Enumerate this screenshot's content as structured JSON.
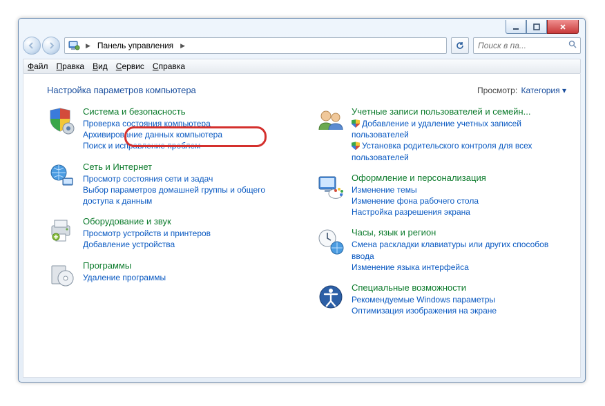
{
  "window": {
    "breadcrumb": "Панель управления",
    "search_placeholder": "Поиск в па..."
  },
  "menu": {
    "file": "Файл",
    "edit": "Правка",
    "view": "Вид",
    "tools": "Сервис",
    "help": "Справка"
  },
  "header": {
    "title": "Настройка параметров компьютера",
    "view_label": "Просмотр:",
    "view_value": "Категория"
  },
  "left": [
    {
      "title": "Система и безопасность",
      "subs": [
        "Проверка состояния компьютера",
        "Архивирование данных компьютера",
        "Поиск и исправление проблем"
      ]
    },
    {
      "title": "Сеть и Интернет",
      "subs": [
        "Просмотр состояния сети и задач",
        "Выбор параметров домашней группы и общего доступа к данным"
      ]
    },
    {
      "title": "Оборудование и звук",
      "subs": [
        "Просмотр устройств и принтеров",
        "Добавление устройства"
      ]
    },
    {
      "title": "Программы",
      "subs": [
        "Удаление программы"
      ]
    }
  ],
  "right": [
    {
      "title": "Учетные записи пользователей и семейн...",
      "subs": [
        {
          "t": "Добавление и удаление учетных записей пользователей",
          "shield": true
        },
        {
          "t": "Установка родительского контроля для всех пользователей",
          "shield": true
        }
      ]
    },
    {
      "title": "Оформление и персонализация",
      "subs": [
        {
          "t": "Изменение темы"
        },
        {
          "t": "Изменение фона рабочего стола"
        },
        {
          "t": "Настройка разрешения экрана"
        }
      ]
    },
    {
      "title": "Часы, язык и регион",
      "subs": [
        {
          "t": "Смена раскладки клавиатуры или других способов ввода"
        },
        {
          "t": "Изменение языка интерфейса"
        }
      ]
    },
    {
      "title": "Специальные возможности",
      "subs": [
        {
          "t": "Рекомендуемые Windows параметры"
        },
        {
          "t": "Оптимизация изображения на экране"
        }
      ]
    }
  ]
}
